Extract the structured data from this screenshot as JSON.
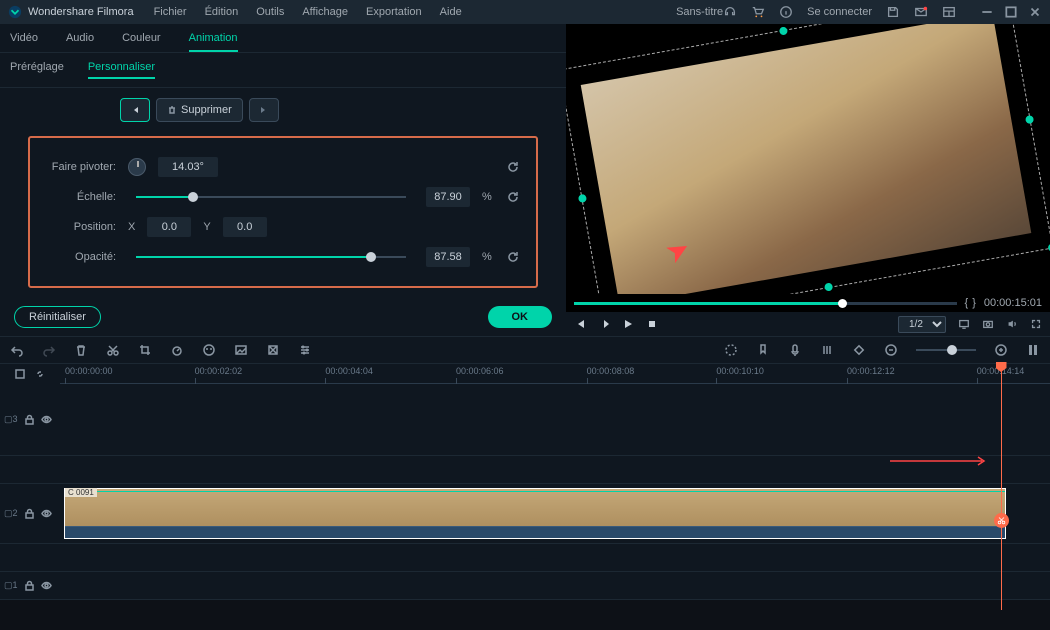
{
  "app": {
    "title": "Wondershare Filmora",
    "doc_title": "Sans-titre",
    "signin": "Se connecter"
  },
  "menubar": [
    "Fichier",
    "Édition",
    "Outils",
    "Affichage",
    "Exportation",
    "Aide"
  ],
  "main_tabs": [
    "Vidéo",
    "Audio",
    "Couleur",
    "Animation"
  ],
  "main_tab_active": 3,
  "sub_tabs": [
    "Préréglage",
    "Personnaliser"
  ],
  "sub_tab_active": 1,
  "buttons": {
    "supprimer": "Supprimer",
    "reinitialiser": "Réinitialiser",
    "ok": "OK"
  },
  "props": {
    "rotate": {
      "label": "Faire pivoter:",
      "value": "14.03°"
    },
    "scale": {
      "label": "Échelle:",
      "value": "87.90",
      "unit": "%",
      "percent": 21
    },
    "position": {
      "label": "Position:",
      "x_label": "X",
      "x": "0.0",
      "y_label": "Y",
      "y": "0.0"
    },
    "opacity": {
      "label": "Opacité:",
      "value": "87.58",
      "unit": "%",
      "percent": 87
    }
  },
  "preview": {
    "timecode": "00:00:15:01",
    "progress_percent": 70,
    "zoom": "1/2"
  },
  "timeline": {
    "ticks": [
      "00:00:00:00",
      "00:00:02:02",
      "00:00:04:04",
      "00:00:06:06",
      "00:00:08:08",
      "00:00:10:10",
      "00:00:12:12",
      "00:00:14:14"
    ],
    "playhead_percent": 95,
    "clip_label": "C 0091",
    "tracks": [
      "3",
      "2",
      "1"
    ]
  }
}
